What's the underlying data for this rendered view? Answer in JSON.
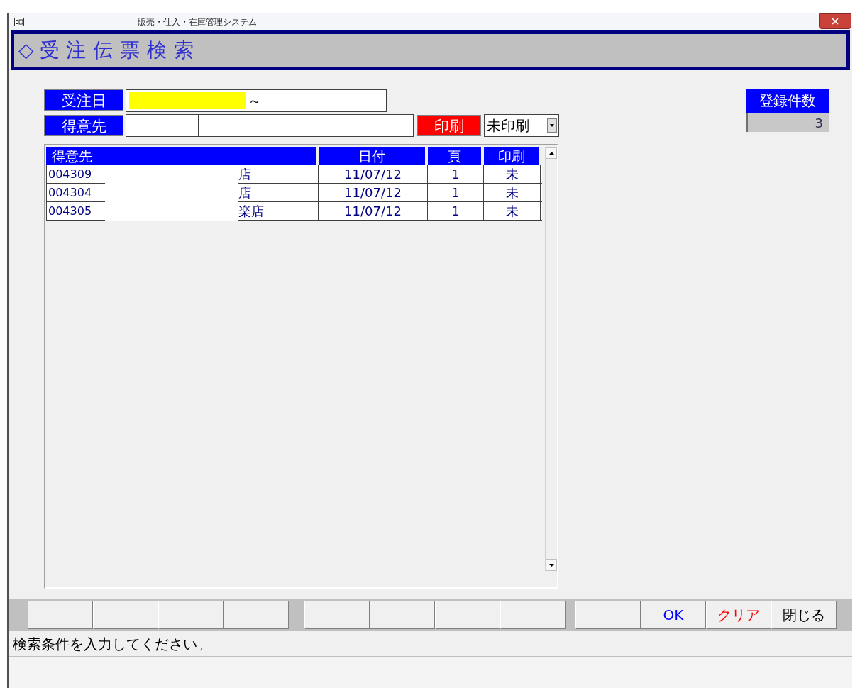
{
  "window": {
    "title": "販売・仕入・在庫管理システム"
  },
  "header": {
    "marker": "◇",
    "title": "受注伝票検索"
  },
  "filters": {
    "order_date": {
      "label": "受注日",
      "separator": "～"
    },
    "customer": {
      "label": "得意先"
    },
    "print": {
      "label": "印刷",
      "value": "未印刷"
    }
  },
  "count": {
    "label": "登録件数",
    "value": "3"
  },
  "table": {
    "columns": [
      "得意先",
      "日付",
      "頁",
      "印刷"
    ],
    "rows": [
      {
        "code": "004309",
        "name": "店",
        "date": "11/07/12",
        "page": "1",
        "print": "未"
      },
      {
        "code": "004304",
        "name": "店",
        "date": "11/07/12",
        "page": "1",
        "print": "未"
      },
      {
        "code": "004305",
        "name": "楽店",
        "date": "11/07/12",
        "page": "1",
        "print": "未"
      }
    ]
  },
  "function_keys": [
    {
      "kind": "blank"
    },
    {
      "kind": "blank"
    },
    {
      "kind": "blank"
    },
    {
      "kind": "blank"
    },
    {
      "kind": "blank"
    },
    {
      "kind": "blank"
    },
    {
      "kind": "blank"
    },
    {
      "kind": "blank"
    },
    {
      "kind": "blank"
    },
    {
      "kind": "text",
      "label": "OK",
      "color": "#0000ff"
    },
    {
      "kind": "text",
      "label": "クリア",
      "color": "#ff0000"
    },
    {
      "kind": "text",
      "label": "閉じる",
      "color": "#000000"
    }
  ],
  "status_bar": {
    "text": "検索条件を入力してください。"
  }
}
